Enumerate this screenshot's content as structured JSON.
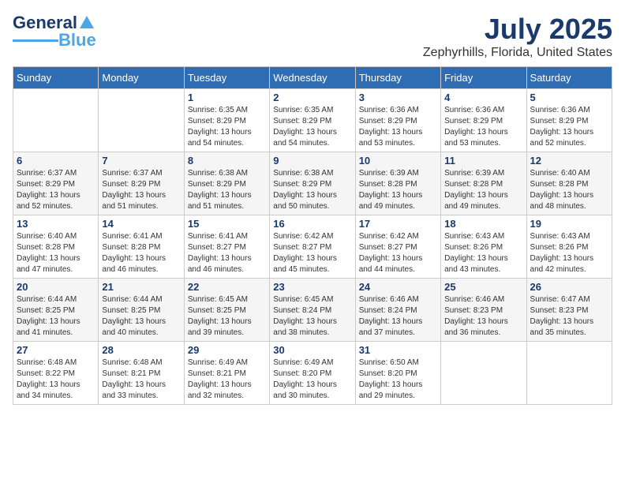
{
  "header": {
    "logo_general": "General",
    "logo_blue": "Blue",
    "title": "July 2025",
    "subtitle": "Zephyrhills, Florida, United States"
  },
  "days_of_week": [
    "Sunday",
    "Monday",
    "Tuesday",
    "Wednesday",
    "Thursday",
    "Friday",
    "Saturday"
  ],
  "weeks": [
    [
      {
        "day": "",
        "details": ""
      },
      {
        "day": "",
        "details": ""
      },
      {
        "day": "1",
        "details": "Sunrise: 6:35 AM\nSunset: 8:29 PM\nDaylight: 13 hours and 54 minutes."
      },
      {
        "day": "2",
        "details": "Sunrise: 6:35 AM\nSunset: 8:29 PM\nDaylight: 13 hours and 54 minutes."
      },
      {
        "day": "3",
        "details": "Sunrise: 6:36 AM\nSunset: 8:29 PM\nDaylight: 13 hours and 53 minutes."
      },
      {
        "day": "4",
        "details": "Sunrise: 6:36 AM\nSunset: 8:29 PM\nDaylight: 13 hours and 53 minutes."
      },
      {
        "day": "5",
        "details": "Sunrise: 6:36 AM\nSunset: 8:29 PM\nDaylight: 13 hours and 52 minutes."
      }
    ],
    [
      {
        "day": "6",
        "details": "Sunrise: 6:37 AM\nSunset: 8:29 PM\nDaylight: 13 hours and 52 minutes."
      },
      {
        "day": "7",
        "details": "Sunrise: 6:37 AM\nSunset: 8:29 PM\nDaylight: 13 hours and 51 minutes."
      },
      {
        "day": "8",
        "details": "Sunrise: 6:38 AM\nSunset: 8:29 PM\nDaylight: 13 hours and 51 minutes."
      },
      {
        "day": "9",
        "details": "Sunrise: 6:38 AM\nSunset: 8:29 PM\nDaylight: 13 hours and 50 minutes."
      },
      {
        "day": "10",
        "details": "Sunrise: 6:39 AM\nSunset: 8:28 PM\nDaylight: 13 hours and 49 minutes."
      },
      {
        "day": "11",
        "details": "Sunrise: 6:39 AM\nSunset: 8:28 PM\nDaylight: 13 hours and 49 minutes."
      },
      {
        "day": "12",
        "details": "Sunrise: 6:40 AM\nSunset: 8:28 PM\nDaylight: 13 hours and 48 minutes."
      }
    ],
    [
      {
        "day": "13",
        "details": "Sunrise: 6:40 AM\nSunset: 8:28 PM\nDaylight: 13 hours and 47 minutes."
      },
      {
        "day": "14",
        "details": "Sunrise: 6:41 AM\nSunset: 8:28 PM\nDaylight: 13 hours and 46 minutes."
      },
      {
        "day": "15",
        "details": "Sunrise: 6:41 AM\nSunset: 8:27 PM\nDaylight: 13 hours and 46 minutes."
      },
      {
        "day": "16",
        "details": "Sunrise: 6:42 AM\nSunset: 8:27 PM\nDaylight: 13 hours and 45 minutes."
      },
      {
        "day": "17",
        "details": "Sunrise: 6:42 AM\nSunset: 8:27 PM\nDaylight: 13 hours and 44 minutes."
      },
      {
        "day": "18",
        "details": "Sunrise: 6:43 AM\nSunset: 8:26 PM\nDaylight: 13 hours and 43 minutes."
      },
      {
        "day": "19",
        "details": "Sunrise: 6:43 AM\nSunset: 8:26 PM\nDaylight: 13 hours and 42 minutes."
      }
    ],
    [
      {
        "day": "20",
        "details": "Sunrise: 6:44 AM\nSunset: 8:25 PM\nDaylight: 13 hours and 41 minutes."
      },
      {
        "day": "21",
        "details": "Sunrise: 6:44 AM\nSunset: 8:25 PM\nDaylight: 13 hours and 40 minutes."
      },
      {
        "day": "22",
        "details": "Sunrise: 6:45 AM\nSunset: 8:25 PM\nDaylight: 13 hours and 39 minutes."
      },
      {
        "day": "23",
        "details": "Sunrise: 6:45 AM\nSunset: 8:24 PM\nDaylight: 13 hours and 38 minutes."
      },
      {
        "day": "24",
        "details": "Sunrise: 6:46 AM\nSunset: 8:24 PM\nDaylight: 13 hours and 37 minutes."
      },
      {
        "day": "25",
        "details": "Sunrise: 6:46 AM\nSunset: 8:23 PM\nDaylight: 13 hours and 36 minutes."
      },
      {
        "day": "26",
        "details": "Sunrise: 6:47 AM\nSunset: 8:23 PM\nDaylight: 13 hours and 35 minutes."
      }
    ],
    [
      {
        "day": "27",
        "details": "Sunrise: 6:48 AM\nSunset: 8:22 PM\nDaylight: 13 hours and 34 minutes."
      },
      {
        "day": "28",
        "details": "Sunrise: 6:48 AM\nSunset: 8:21 PM\nDaylight: 13 hours and 33 minutes."
      },
      {
        "day": "29",
        "details": "Sunrise: 6:49 AM\nSunset: 8:21 PM\nDaylight: 13 hours and 32 minutes."
      },
      {
        "day": "30",
        "details": "Sunrise: 6:49 AM\nSunset: 8:20 PM\nDaylight: 13 hours and 30 minutes."
      },
      {
        "day": "31",
        "details": "Sunrise: 6:50 AM\nSunset: 8:20 PM\nDaylight: 13 hours and 29 minutes."
      },
      {
        "day": "",
        "details": ""
      },
      {
        "day": "",
        "details": ""
      }
    ]
  ]
}
